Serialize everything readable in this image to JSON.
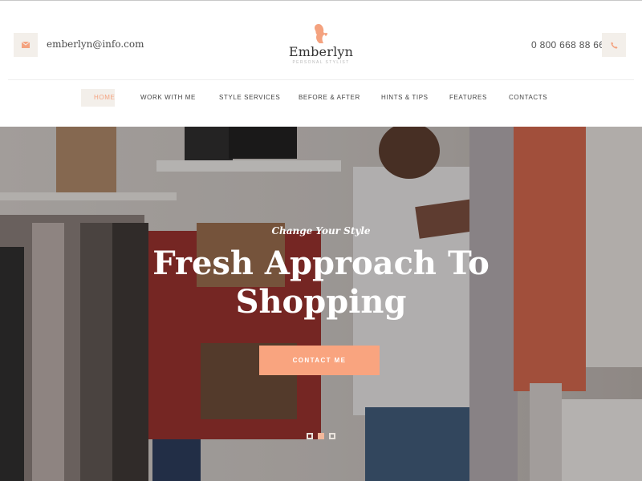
{
  "header": {
    "email": "emberlyn@info.com",
    "email_icon": "envelope-icon",
    "phone": "0 800 668 88 66",
    "phone_icon": "phone-icon",
    "logo": {
      "name": "Emberlyn",
      "tagline": "PERSONAL STYLIST",
      "icon": "woman-silhouette-heart-icon"
    }
  },
  "nav": {
    "items": [
      {
        "label": "HOME",
        "active": true
      },
      {
        "label": "WORK WITH ME",
        "active": false
      },
      {
        "label": "STYLE SERVICES",
        "active": false
      },
      {
        "label": "BEFORE & AFTER",
        "active": false
      },
      {
        "label": "HINTS & TIPS",
        "active": false
      },
      {
        "label": "FEATURES",
        "active": false
      },
      {
        "label": "CONTACTS",
        "active": false
      }
    ]
  },
  "hero": {
    "subtitle": "Change Your Style",
    "title_line1": "Fresh Approach To",
    "title_line2": "Shopping",
    "cta_label": "CONTACT ME",
    "slider": {
      "count": 3,
      "active_index": 1
    }
  },
  "colors": {
    "accent": "#f9a47f",
    "icon_bg": "#f3efea",
    "text_dark": "#333333"
  }
}
